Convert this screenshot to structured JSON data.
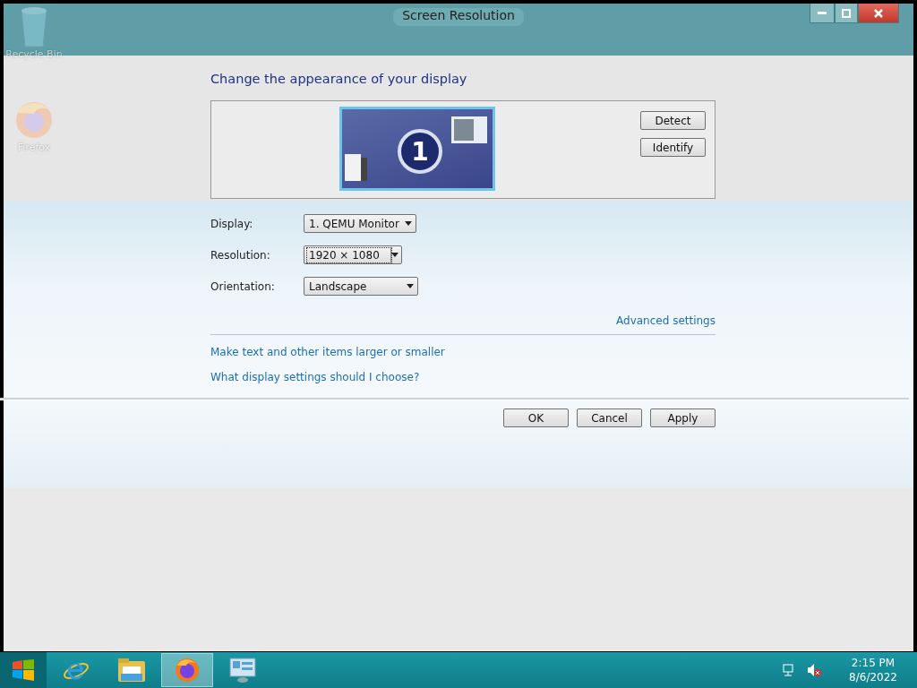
{
  "window": {
    "title": "Screen Resolution"
  },
  "desktop_icons": [
    {
      "label": "Recycle Bin",
      "kind": "bin"
    },
    {
      "label": "Firefox",
      "kind": "firefox"
    }
  ],
  "heading": "Change the appearance of your display",
  "monitor_preview": {
    "number": "1",
    "selected": true
  },
  "preview_buttons": [
    "Detect",
    "Identify"
  ],
  "fields": [
    {
      "label": "Display:",
      "value": "1. QEMU Monitor",
      "focused": false
    },
    {
      "label": "Resolution:",
      "value": "1920 × 1080",
      "focused": true
    },
    {
      "label": "Orientation:",
      "value": "Landscape",
      "focused": false
    }
  ],
  "advanced_link": "Advanced settings",
  "links": [
    "Make text and other items larger or smaller",
    "What display settings should I choose?"
  ],
  "buttons": [
    "OK",
    "Cancel",
    "Apply"
  ],
  "taskbar": {
    "apps": [
      {
        "kind": "ie",
        "selected": false
      },
      {
        "kind": "explorer",
        "selected": false
      },
      {
        "kind": "firefox",
        "selected": true
      },
      {
        "kind": "display",
        "selected": false
      }
    ],
    "time": "2:15 PM",
    "date": "8/6/2022"
  }
}
